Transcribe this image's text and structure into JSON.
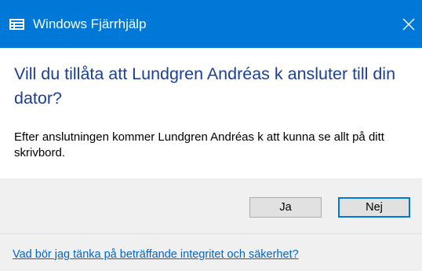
{
  "window": {
    "title": "Windows Fjärrhjälp",
    "app_icon": "remote-assistance-icon",
    "close_icon": "close-icon",
    "titlebar_color": "#0078d7"
  },
  "dialog": {
    "heading": "Vill du tillåta att Lundgren Andréas k ansluter till din dator?",
    "body": "Efter anslutningen kommer Lundgren Andréas k att kunna se allt på ditt skrivbord.",
    "heading_color": "#1c3f94"
  },
  "buttons": {
    "yes_label": "Ja",
    "no_label": "Nej",
    "focused": "Nej",
    "focus_color": "#0078d7"
  },
  "footer": {
    "privacy_link": "Vad bör jag tänka på beträffande integritet och säkerhet?",
    "link_color": "#0066cc"
  }
}
